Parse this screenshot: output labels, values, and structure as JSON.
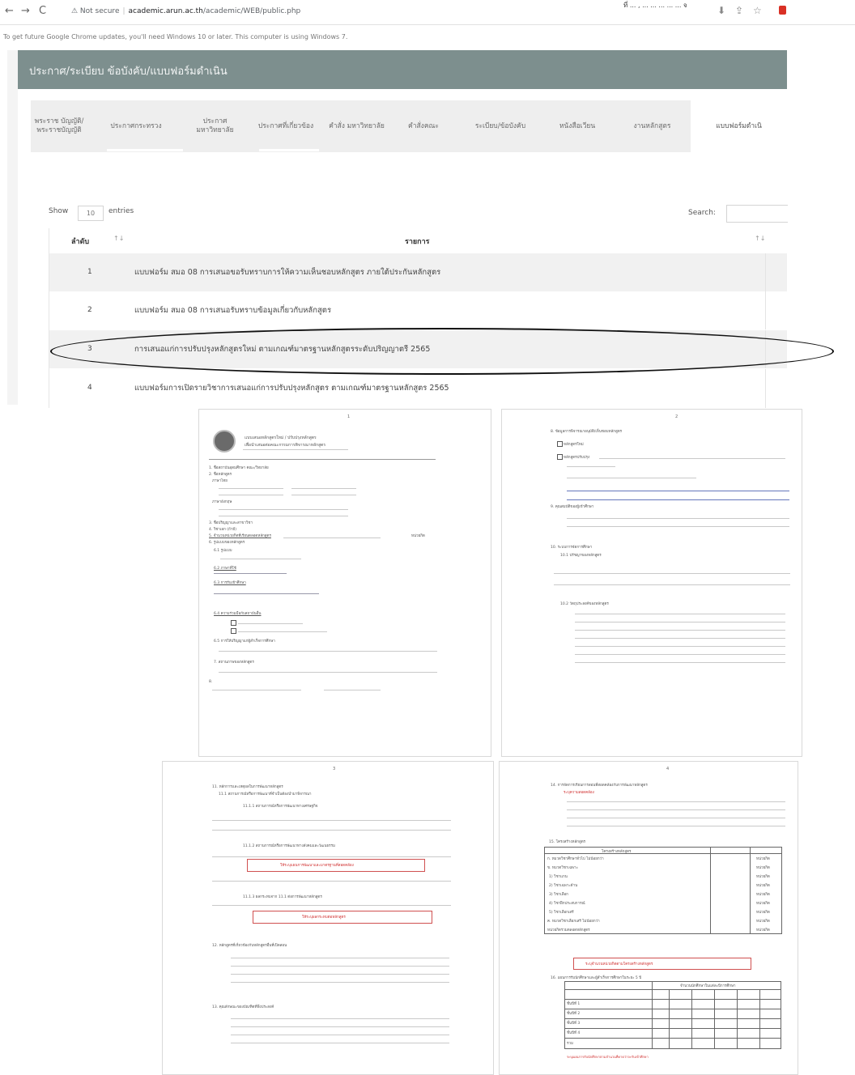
{
  "browser": {
    "back": "←",
    "forward": "→",
    "reload": "C",
    "warn": "⚠ Not secure",
    "host": "academic.arun.ac.th",
    "path": "/academic/WEB/public.php",
    "ext_icons": [
      "download-icon",
      "share-icon",
      "star-icon"
    ],
    "top_right": "ที่ ... , ... ... ... ... ... จ"
  },
  "infobar": "To get future Google Chrome updates, you'll need Windows 10 or later. This computer is using Windows 7.",
  "site": {
    "header_title": "ประกาศ/ระเบียบ ข้อบังคับ/แบบฟอร์มดำเนิน",
    "tabs": [
      "พระราช บัญญัติ/ พระราชบัญญัติ",
      "ประกาศกระทรวง",
      "ประกาศ มหาวิทยาลัย",
      "ประกาศที่เกี่ยวข้อง",
      "คำสั่ง มหาวิทยาลัย",
      "คำสั่งคณะ",
      "ระเบียบ/ข้อบังคับ",
      "หนังสือเวียน",
      "งานหลักสูตร",
      "แบบฟอร์มดำเนิ"
    ],
    "show_label": "Show",
    "show_value": "10",
    "entries_label": "entries",
    "search_label": "Search:",
    "columns": [
      "ลำดับ",
      "รายการ"
    ],
    "rows": [
      {
        "num": "1",
        "text": "แบบฟอร์ม สมอ 08 การเสนอขอรับทราบการให้ความเห็นชอบหลักสูตร ภายใต้ประกันหลักสูตร"
      },
      {
        "num": "2",
        "text": "แบบฟอร์ม สมอ 08 การเสนอรับทราบข้อมูลเกี่ยวกับหลักสูตร"
      },
      {
        "num": "3",
        "text": "การเสนอแก่การปรับปรุงหลักสูตรใหม่ ตามเกณฑ์มาตรฐานหลักสูตรระดับปริญญาตรี 2565"
      },
      {
        "num": "4",
        "text": "แบบฟอร์มการเปิดรายวิชาการเสนอแก่การปรับปรุงหลักสูตร ตามเกณฑ์มาตรฐานหลักสูตร 2565"
      }
    ]
  },
  "documents": {
    "page1": {
      "number": "1",
      "title": "แบบเสนอหลักสูตรใหม่ / ปรับปรุงหลักสูตร",
      "subtitle": "เพื่อนำเสนอต่อคณะกรรมการพิจารณาหลักสูตร",
      "items": [
        "1. ชื่อสถาบันอุดมศึกษา คณะ/วิทยาลัย",
        "2. ชื่อหลักสูตร",
        "ภาษาไทย",
        "ภาษาอังกฤษ",
        "3. ชื่อปริญญาและสาขาวิชา",
        "4. วิชาเอก (ถ้ามี)",
        "5. จำนวนหน่วยกิตที่เรียนตลอดหลักสูตร",
        "6. รูปแบบของหลักสูตร",
        "6.1 รูปแบบ",
        "6.2 ภาษาที่ใช้",
        "6.3 การรับเข้าศึกษา",
        "6.4 ความร่วมมือกับสถาบันอื่น",
        "6.5 การให้ปริญญาแก่ผู้สำเร็จการศึกษา",
        "7. สถานภาพของหลักสูตร"
      ],
      "units": "หน่วยกิต"
    },
    "page2": {
      "number": "2",
      "items": [
        "8. ข้อมูลการพิจารณาอนุมัติ/เห็นชอบหลักสูตร",
        "หลักสูตรใหม่",
        "หลักสูตรปรับปรุง",
        "9. คุณสมบัติของผู้เข้าศึกษา",
        "10. ระบบการจัดการศึกษา",
        "10.1 ปรัชญาของหลักสูตร",
        "10.2 วัตถุประสงค์ของหลักสูตร"
      ]
    },
    "page3": {
      "number": "3",
      "items": [
        "11. หลักการและเหตุผลในการพัฒนาหลักสูตร",
        "11.1 สถานการณ์หรือการพัฒนาที่จำเป็นต้องนำมาพิจารณา",
        "11.1.1 สถานการณ์หรือการพัฒนาทางเศรษฐกิจ",
        "11.1.2 สถานการณ์หรือการพัฒนาทางสังคมและวัฒนธรรม",
        "11.1.3 ผลกระทบจาก 11.1 ต่อการพัฒนาหลักสูตร",
        "12. หลักสูตรที่เกี่ยวข้องกับหลักสูตรอื่นที่เปิดสอน",
        "13. คุณลักษณะของบัณฑิตที่พึงประสงค์"
      ],
      "red_notes": [
        "ให้ระบุแผนการพัฒนาและมาตรฐานที่สอดคล้อง",
        "ให้ระบุผลกระทบต่อหลักสูตร"
      ]
    },
    "page4": {
      "number": "4",
      "items": [
        "14. การจัดการเรียนการสอนที่สอดคล้องกับการพัฒนาหลักสูตร",
        "15. โครงสร้างหลักสูตร",
        "16. แผนการรับนักศึกษาและผู้สำเร็จการศึกษาในระยะ 5 ปี"
      ],
      "red_note": "ระบุจำนวนหน่วยกิตตามโครงสร้างหลักสูตร",
      "table_header": "โครงสร้างหลักสูตร",
      "table_rows": [
        "ก. หมวดวิชาศึกษาทั่วไป ไม่น้อยกว่า",
        "ข. หมวดวิชาเฉพาะ",
        "1) วิชาแกน",
        "2) วิชาเฉพาะด้าน",
        "3) วิชาเลือก",
        "4) วิชาฝึกประสบการณ์",
        "5) วิชาเลือกเสรี",
        "ค. หมวดวิชาเลือกเสรี ไม่น้อยกว่า",
        "หน่วยกิตรวมตลอดหลักสูตร"
      ],
      "unit_label": "หน่วยกิต",
      "plan_rows": [
        "ชั้นปีที่ 1",
        "ชั้นปีที่ 2",
        "ชั้นปีที่ 3",
        "ชั้นปีที่ 4",
        "รวม"
      ],
      "red_note2": "ระบุแผนการรับนักศึกษาตามจำนวนที่คาดว่าจะรับเข้าศึกษา",
      "plan_header": "จำนวนนักศึกษาในแต่ละปีการศึกษา"
    }
  }
}
